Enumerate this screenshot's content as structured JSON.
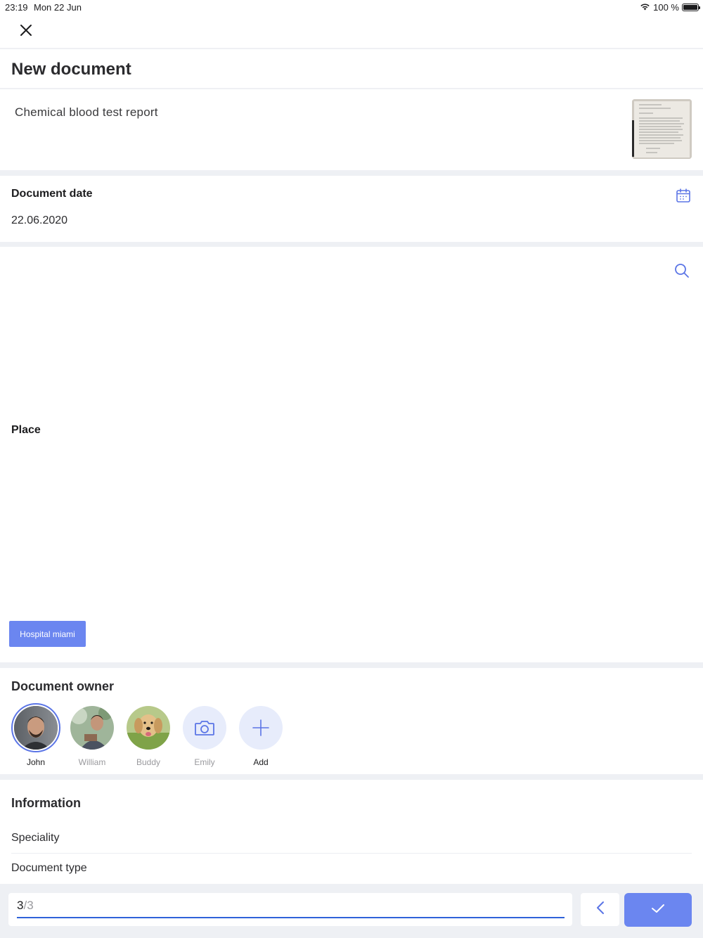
{
  "status_bar": {
    "time": "23:19",
    "date": "Mon 22 Jun",
    "battery": "100 %",
    "wifi_icon": "wifi-icon",
    "battery_icon": "battery-icon"
  },
  "nav": {
    "close_icon": "close-icon"
  },
  "page": {
    "title": "New document"
  },
  "document": {
    "name": "Chemical blood test report",
    "thumbnail_icon": "document-thumbnail"
  },
  "date_field": {
    "label": "Document date",
    "value": "22.06.2020",
    "icon": "calendar-icon"
  },
  "place_field": {
    "label": "Place",
    "search_icon": "search-icon",
    "chip": "Hospital miami"
  },
  "owners": {
    "title": "Document owner",
    "items": [
      {
        "name": "John",
        "selected": true,
        "icon": "avatar-photo"
      },
      {
        "name": "William",
        "selected": false,
        "icon": "avatar-photo"
      },
      {
        "name": "Buddy",
        "selected": false,
        "icon": "avatar-photo-dog"
      },
      {
        "name": "Emily",
        "selected": false,
        "icon": "camera-icon"
      },
      {
        "name": "Add",
        "selected": false,
        "icon": "plus-icon"
      }
    ]
  },
  "information": {
    "title": "Information",
    "rows": [
      "Speciality",
      "Document type"
    ]
  },
  "footer": {
    "step_current": "3",
    "step_total": "/3",
    "progress": 1.0,
    "back_icon": "chevron-left-icon",
    "confirm_icon": "check-icon"
  },
  "colors": {
    "accent": "#6b86f0",
    "progress": "#2f62d9",
    "background": "#eef0f4"
  }
}
